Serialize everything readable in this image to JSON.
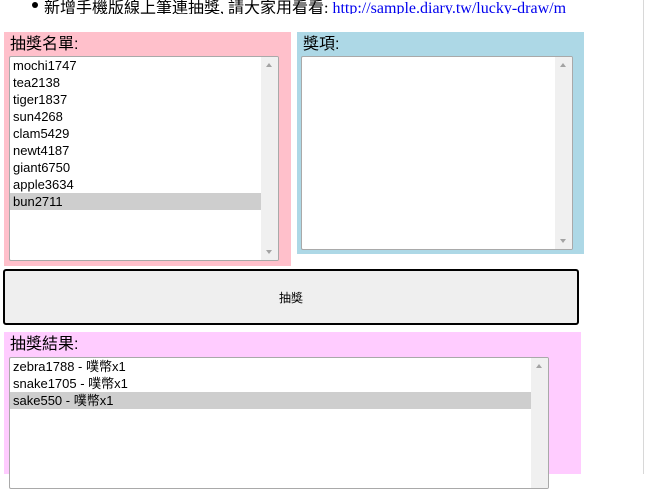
{
  "notice": {
    "text": "新增手機版線上筆連抽獎, 請大家用看看: ",
    "link_text": "http://sample.diary.tw/lucky-draw/m"
  },
  "names_panel": {
    "title": "抽獎名單:",
    "background": "#ffc0cb",
    "items": [
      "mochi1747",
      "tea2138",
      "tiger1837",
      "sun4268",
      "clam5429",
      "newt4187",
      "giant6750",
      "apple3634",
      "bun2711"
    ],
    "selected_index": 8
  },
  "prizes_panel": {
    "title": "獎項:",
    "background": "#add8e6",
    "items": []
  },
  "draw_button": {
    "label": "抽獎"
  },
  "results_panel": {
    "title": "抽獎結果:",
    "background": "#ffccff",
    "items": [
      "zebra1788 - 噗幣x1",
      "snake1705 - 噗幣x1",
      "sake550 - 噗幣x1"
    ],
    "selected_index": 2
  }
}
